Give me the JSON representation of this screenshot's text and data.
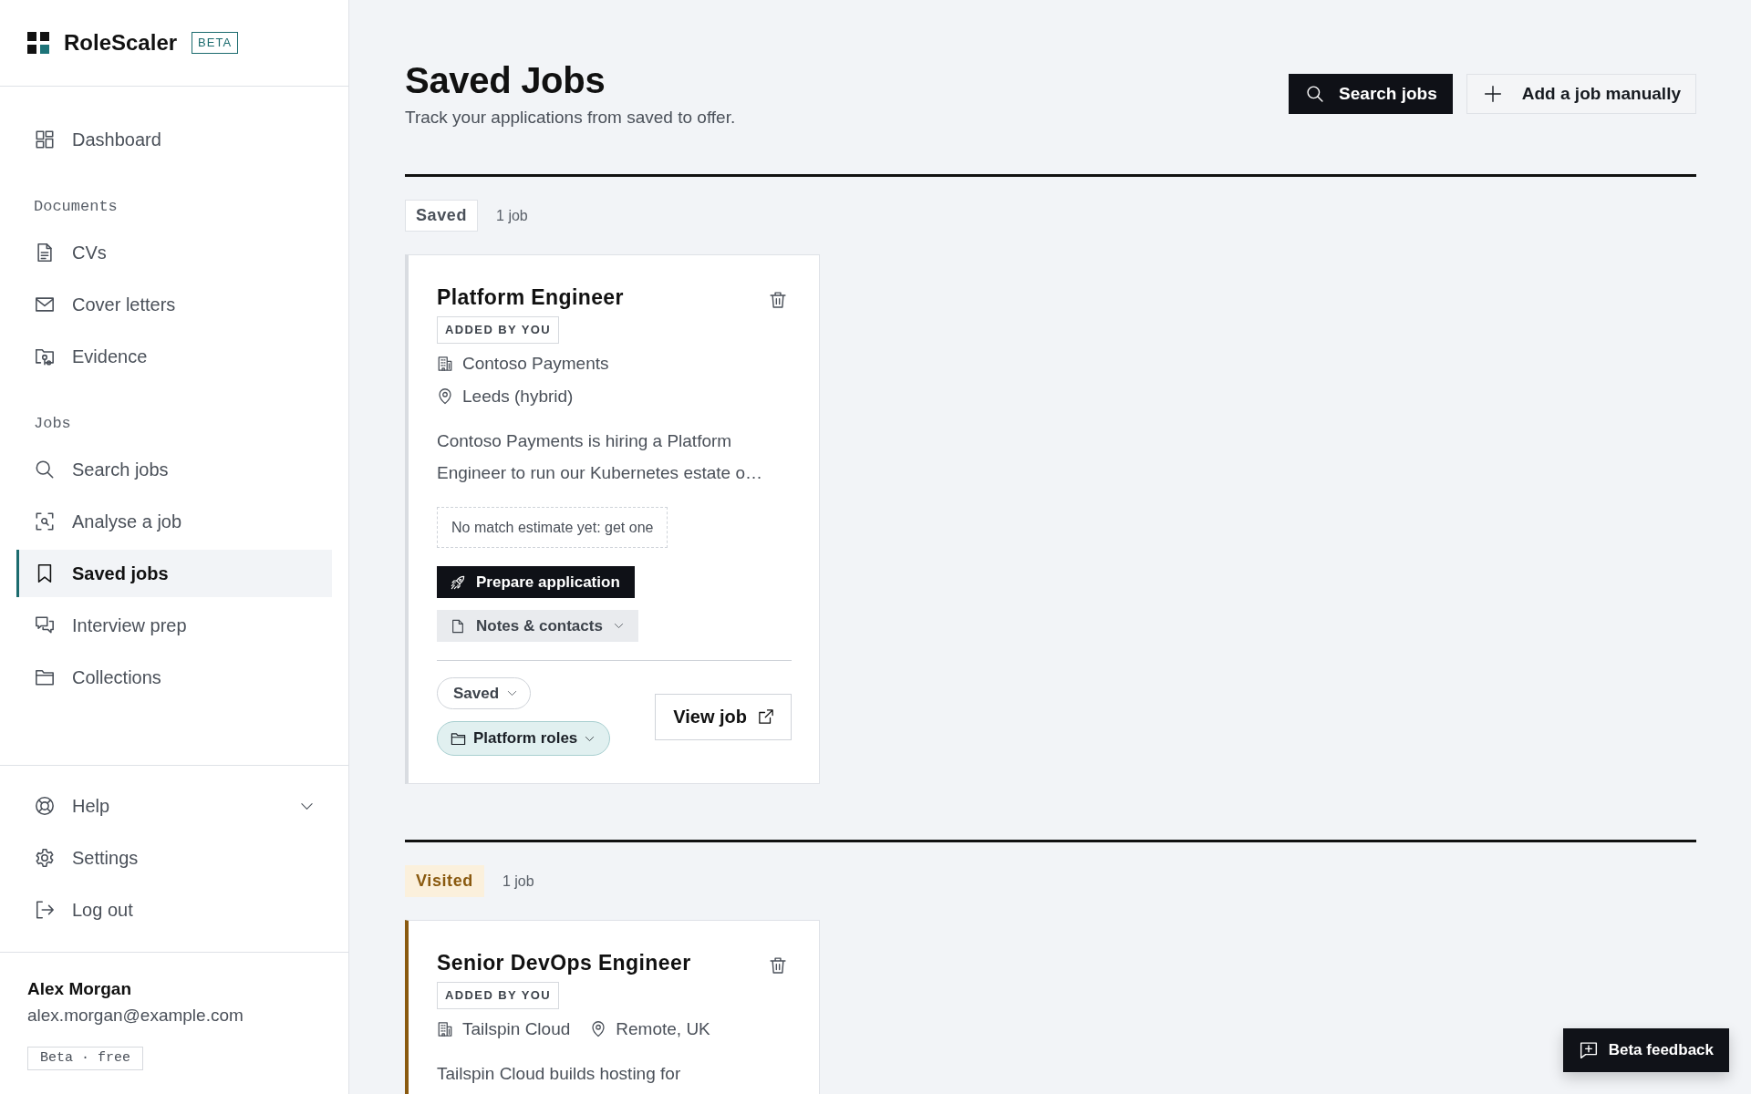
{
  "sidebar": {
    "brand": {
      "name": "RoleScaler",
      "badge": "BETA"
    },
    "sections": [
      {
        "items": [
          {
            "label": "Dashboard",
            "selected": false
          }
        ]
      },
      {
        "heading": "Documents",
        "items": [
          {
            "label": "CVs",
            "selected": false
          },
          {
            "label": "Cover letters",
            "selected": false
          },
          {
            "label": "Evidence",
            "selected": false
          }
        ]
      },
      {
        "heading": "Jobs",
        "items": [
          {
            "label": "Search jobs",
            "selected": false
          },
          {
            "label": "Analyse a job",
            "selected": false
          },
          {
            "label": "Saved jobs",
            "selected": true
          },
          {
            "label": "Interview prep",
            "selected": false
          },
          {
            "label": "Collections",
            "selected": false
          }
        ]
      }
    ],
    "help": {
      "label": "Help",
      "expanded": false
    },
    "links": [
      {
        "label": "Settings"
      },
      {
        "label": "Log out"
      }
    ],
    "user": {
      "name": "Alex Morgan",
      "email": "alex.morgan@example.com",
      "plan": "Beta · free"
    }
  },
  "header": {
    "title": "Saved Jobs",
    "subtitle": "Track your applications from saved to offer.",
    "actions": [
      {
        "kind": "primary",
        "label": "Search jobs"
      },
      {
        "kind": "secondary",
        "label": "Add a job manually"
      }
    ]
  },
  "stages": [
    {
      "kind": "saved",
      "label": "Saved",
      "count": "1 job",
      "jobs": [
        {
          "title": "Platform Engineer",
          "source": "ADDED BY YOU",
          "company": "Contoso Payments",
          "location": "Leeds (hybrid)",
          "description": "Contoso Payments is hiring a Platform Engineer to run our Kubernetes estate o…",
          "match": "No match estimate yet: get one",
          "prepare": "Prepare application",
          "notes": {
            "label": "Notes & contacts",
            "expanded": false
          },
          "status": "Saved",
          "collection": "Platform roles",
          "view": "View job"
        }
      ]
    },
    {
      "kind": "visited",
      "label": "Visited",
      "count": "1 job",
      "jobs": [
        {
          "title": "Senior DevOps Engineer",
          "source": "ADDED BY YOU",
          "company": "Tailspin Cloud",
          "location": "Remote, UK",
          "description": "Tailspin Cloud builds hosting for"
        }
      ]
    }
  ],
  "feedback_button": {
    "label": "Beta feedback"
  }
}
